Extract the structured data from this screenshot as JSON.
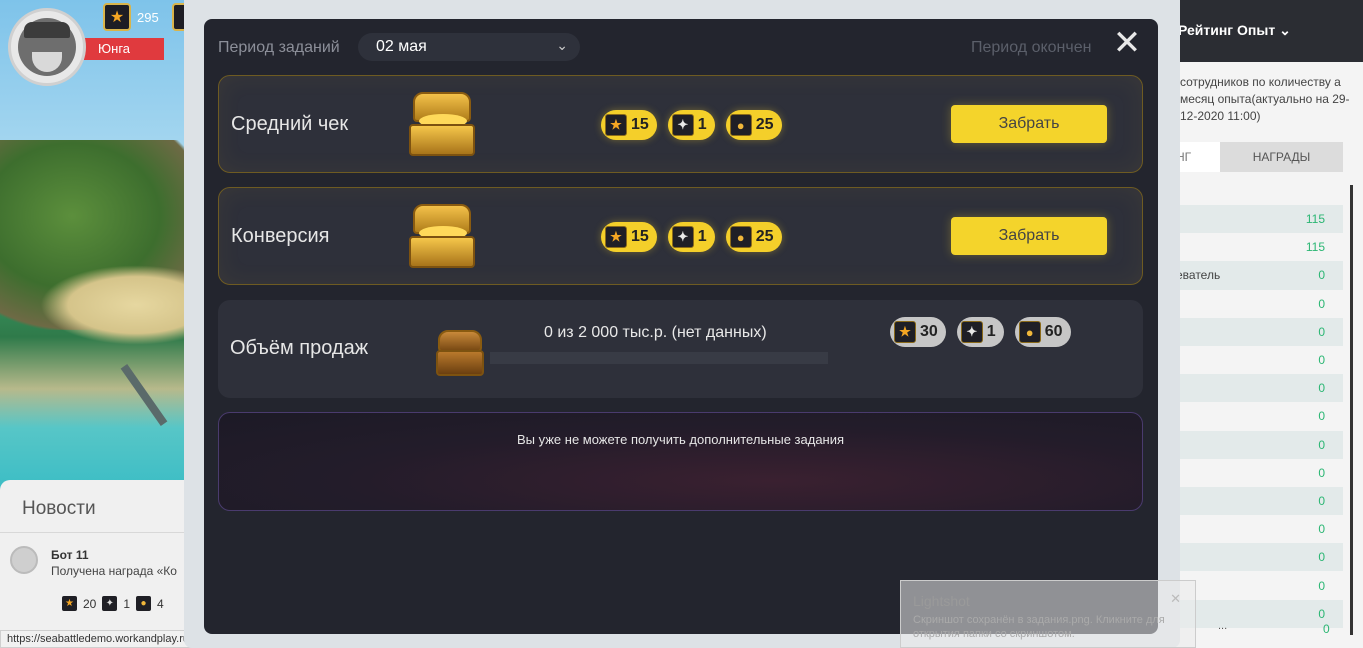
{
  "top_bar": {
    "stars_value": "295",
    "rank_label": "Юнга"
  },
  "news": {
    "title": "Новости",
    "item": {
      "author": "Бот 11",
      "text": "Получена награда «Ко",
      "rewards": [
        {
          "icon": "star-icon",
          "value": "20"
        },
        {
          "icon": "cannon-icon",
          "value": "1"
        },
        {
          "icon": "coins-icon",
          "value": "4"
        }
      ]
    }
  },
  "status_url": "https://seabattledemo.workandplay.ru/#",
  "rating": {
    "title": "Рейтинг Опыт",
    "description": "сотрудников по количеству а месяц опыта(актуально на 29-12-2020 11:00)",
    "tab_rating": "НГ",
    "tab_rewards": "НАГРАДЫ",
    "rows": [
      {
        "name": "",
        "value": "115"
      },
      {
        "name": "",
        "value": "115"
      },
      {
        "name": "еватель",
        "value": "0"
      },
      {
        "name": "",
        "value": "0"
      },
      {
        "name": "",
        "value": "0"
      },
      {
        "name": "",
        "value": "0"
      },
      {
        "name": "",
        "value": "0"
      },
      {
        "name": "",
        "value": "0"
      },
      {
        "name": "",
        "value": "0"
      },
      {
        "name": "",
        "value": "0"
      },
      {
        "name": "",
        "value": "0"
      },
      {
        "name": "",
        "value": "0"
      },
      {
        "name": "",
        "value": "0"
      },
      {
        "name": "",
        "value": "0"
      },
      {
        "name": "",
        "value": "0"
      }
    ],
    "footer_dots": "...",
    "footer_value": "0"
  },
  "toast": {
    "title": "Lightshot",
    "text": "Скриншот сохранён в задания.png. Кликните для открытия папки со скриншотом."
  },
  "modal": {
    "period_label": "Период заданий",
    "period_value": "02 мая",
    "period_status": "Период окончен",
    "tasks": [
      {
        "name": "Средний чек",
        "rewards": [
          {
            "icon": "star-icon",
            "value": "15"
          },
          {
            "icon": "cannon-icon",
            "value": "1"
          },
          {
            "icon": "coins-icon",
            "value": "25"
          }
        ],
        "claim_label": "Забрать"
      },
      {
        "name": "Конверсия",
        "rewards": [
          {
            "icon": "star-icon",
            "value": "15"
          },
          {
            "icon": "cannon-icon",
            "value": "1"
          },
          {
            "icon": "coins-icon",
            "value": "25"
          }
        ],
        "claim_label": "Забрать"
      },
      {
        "name": "Объём продаж",
        "progress_text": "0 из 2 000 тыс.р. (нет данных)",
        "progress_fraction": 0,
        "rewards": [
          {
            "icon": "star-icon",
            "value": "30"
          },
          {
            "icon": "cannon-icon",
            "value": "1"
          },
          {
            "icon": "coins-icon",
            "value": "60"
          }
        ]
      }
    ],
    "notice": "Вы уже не можете получить дополнительные задания"
  },
  "colors": {
    "accent_yellow": "#f4d42b",
    "modal_bg": "#23252e",
    "card_bg": "#2e303a",
    "rank_red": "#e03a3e",
    "value_green": "#2bb673"
  }
}
